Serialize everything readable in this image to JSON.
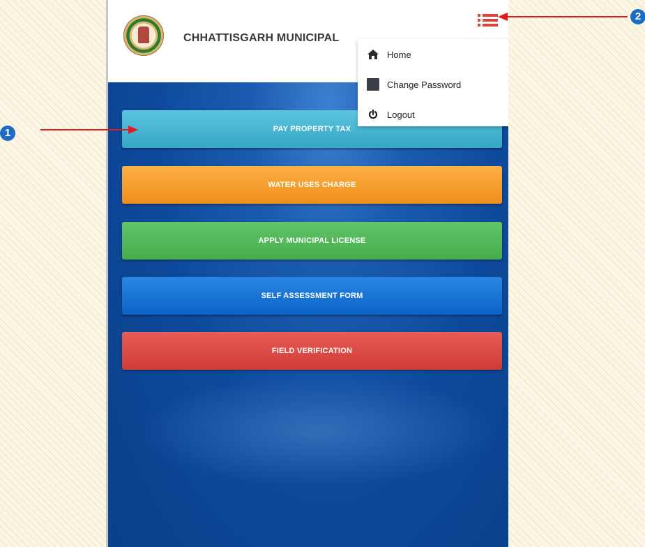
{
  "header": {
    "title": "CHHATTISGARH MUNICIPAL",
    "emblem_icon": "state-emblem-icon",
    "menu_icon": "hamburger-menu-icon"
  },
  "dropdown": {
    "items": [
      {
        "label": "Home",
        "icon": "home-icon"
      },
      {
        "label": "Change Password",
        "icon": "password-icon"
      },
      {
        "label": "Logout",
        "icon": "power-icon"
      }
    ]
  },
  "buttons": [
    {
      "label": "PAY PROPERTY TAX",
      "color": "#45b4d1"
    },
    {
      "label": "WATER USES CHARGE",
      "color": "#f59f2c"
    },
    {
      "label": "APPLY MUNICIPAL LICENSE",
      "color": "#55b85b"
    },
    {
      "label": "SELF ASSESSMENT FORM",
      "color": "#1a74d6"
    },
    {
      "label": "FIELD VERIFICATION",
      "color": "#db4a45"
    }
  ],
  "annotations": {
    "callout_1": "1",
    "callout_2": "2",
    "arrow_color": "#e41b1b"
  }
}
